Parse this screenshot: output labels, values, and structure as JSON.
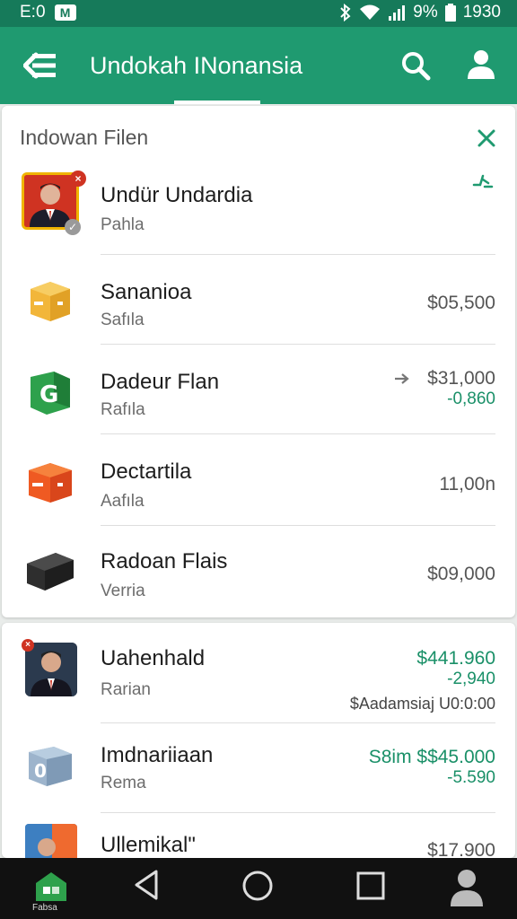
{
  "status": {
    "left_text": "E:0",
    "right_text": "1930",
    "battery_text": "9%"
  },
  "appbar": {
    "title": "Undokah INonansia"
  },
  "card1": {
    "header": "Indowan Filen",
    "rows": [
      {
        "name": "Undür Undardia",
        "sub": "Pahla",
        "amount": "",
        "amount2": ""
      },
      {
        "name": "Sananioa",
        "sub": "Safıla",
        "amount": "$05,500",
        "amount2": ""
      },
      {
        "name": "Dadeur Flan",
        "sub": "Rafıla",
        "amount": "$31,000",
        "amount2": "-0,860"
      },
      {
        "name": "Dectartila",
        "sub": "Aafıla",
        "amount": "11,00n",
        "amount2": ""
      },
      {
        "name": "Radoan Flais",
        "sub": "Verria",
        "amount": "$09,000",
        "amount2": ""
      }
    ]
  },
  "card2": {
    "rows": [
      {
        "name": "Uahenhald",
        "sub": "Rarian",
        "amount": "$441.960",
        "amount2": "-2,940",
        "note": "$Aadamsiaj U0:0:00"
      },
      {
        "name": "Imdnariiaan",
        "sub": "Rema",
        "amount": "S8im  $$45.000",
        "amount2": "-5.590",
        "note": ""
      },
      {
        "name": "Ullemikal\"",
        "sub": "",
        "amount": "$17.900",
        "amount2": "",
        "note": ""
      }
    ]
  },
  "navbar": {
    "home_label": "Fabsa"
  },
  "colors": {
    "primary": "#1f9a70",
    "primary_dark": "#167a5a",
    "green_text": "#1a9068",
    "accent_red": "#cf3322"
  }
}
